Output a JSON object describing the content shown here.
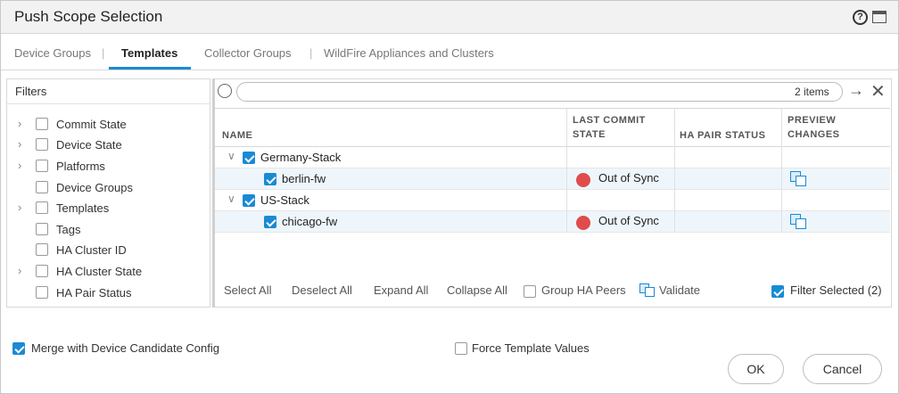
{
  "dialog": {
    "title": "Push Scope Selection",
    "help_icon": "question-circle-icon",
    "maximize_icon": "maximize-icon"
  },
  "tabs": [
    {
      "label": "Device Groups",
      "active": false
    },
    {
      "label": "Templates",
      "active": true
    },
    {
      "label": "Collector Groups",
      "active": false
    },
    {
      "label": "WildFire Appliances and Clusters",
      "active": false
    }
  ],
  "filters": {
    "title": "Filters",
    "items": [
      {
        "label": "Commit State",
        "expandable": true
      },
      {
        "label": "Device State",
        "expandable": true
      },
      {
        "label": "Platforms",
        "expandable": true
      },
      {
        "label": "Device Groups",
        "expandable": false
      },
      {
        "label": "Templates",
        "expandable": true
      },
      {
        "label": "Tags",
        "expandable": false
      },
      {
        "label": "HA Cluster ID",
        "expandable": false
      },
      {
        "label": "HA Cluster State",
        "expandable": true
      },
      {
        "label": "HA Pair Status",
        "expandable": false
      }
    ]
  },
  "search": {
    "placeholder": "",
    "items_count": "2 items"
  },
  "table": {
    "headers": {
      "name": "NAME",
      "last_commit_1": "LAST COMMIT",
      "last_commit_2": "STATE",
      "ha_pair": "HA PAIR STATUS",
      "preview_1": "PREVIEW",
      "preview_2": "CHANGES"
    },
    "rows": [
      {
        "name": "Germany-Stack",
        "level": 0,
        "checked": true,
        "status": "",
        "preview": false
      },
      {
        "name": "berlin-fw",
        "level": 1,
        "checked": true,
        "status": "Out of Sync",
        "status_color": "#e04b4b",
        "preview": true
      },
      {
        "name": "US-Stack",
        "level": 0,
        "checked": true,
        "status": "",
        "preview": false
      },
      {
        "name": "chicago-fw",
        "level": 1,
        "checked": true,
        "status": "Out of Sync",
        "status_color": "#e04b4b",
        "preview": true
      }
    ]
  },
  "grid_footer": {
    "select_all": "Select All",
    "deselect_all": "Deselect All",
    "expand_all": "Expand All",
    "collapse_all": "Collapse All",
    "group_ha_peers": "Group HA Peers",
    "group_ha_peers_checked": false,
    "validate": "Validate",
    "filter_selected": "Filter Selected (2)",
    "filter_selected_checked": true
  },
  "options": {
    "merge_label": "Merge with Device Candidate Config",
    "merge_checked": true,
    "force_label": "Force Template Values",
    "force_checked": false
  },
  "buttons": {
    "ok": "OK",
    "cancel": "Cancel"
  },
  "colors": {
    "accent": "#1a8ad4",
    "out_of_sync": "#e04b4b"
  }
}
